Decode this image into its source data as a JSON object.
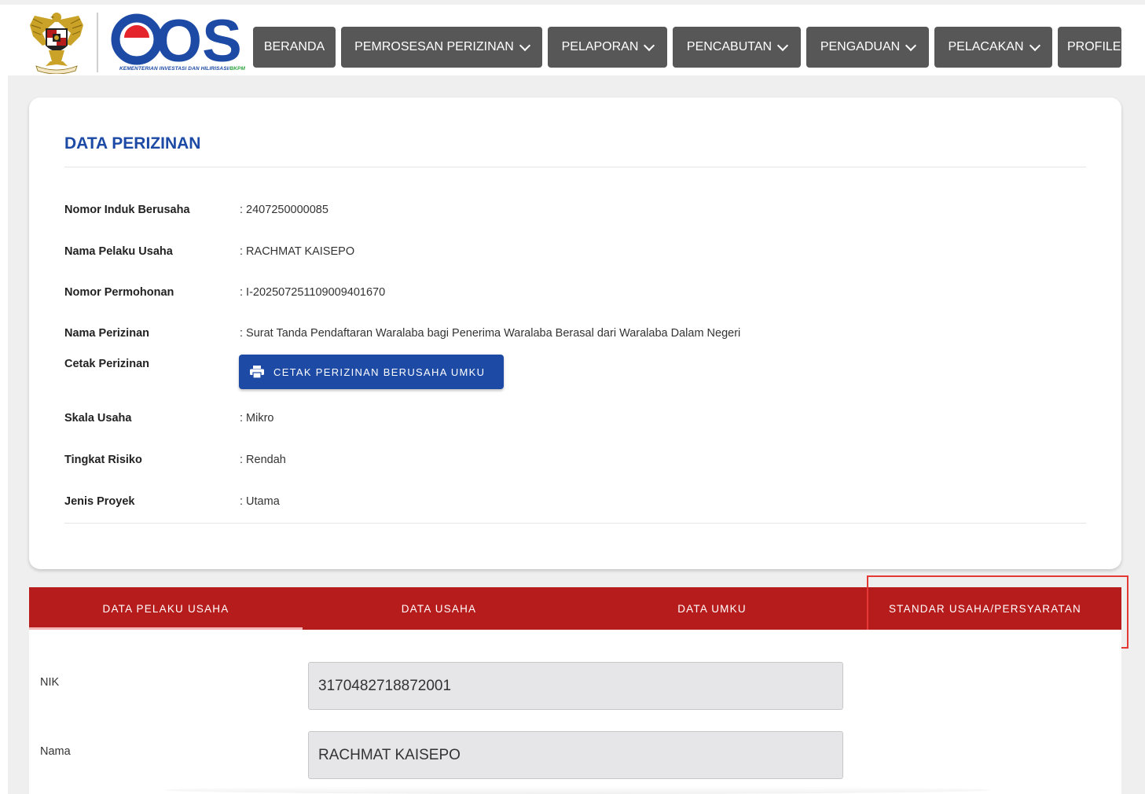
{
  "header": {
    "logo_text": "OSS",
    "logo_subtitle": "KEMENTERIAN INVESTASI DAN HILIRISASI/",
    "logo_subtitle_accent": "BKPM",
    "nav": [
      {
        "label": "BERANDA"
      },
      {
        "label": "PEMROSESAN PERIZINAN"
      },
      {
        "label": "PELAPORAN"
      },
      {
        "label": "PENCABUTAN"
      },
      {
        "label": "PENGADUAN"
      },
      {
        "label": "PELACAKAN"
      },
      {
        "label": "PROFILE"
      }
    ]
  },
  "card": {
    "title": "DATA PERIZINAN",
    "rows": [
      {
        "label": "Nomor Induk Berusaha",
        "value": ": 2407250000085"
      },
      {
        "label": "Nama Pelaku Usaha",
        "value": ": RACHMAT KAISEPO"
      },
      {
        "label": "Nomor Permohonan",
        "value": ": I-202507251109009401670"
      },
      {
        "label": "Nama Perizinan",
        "value": ": Surat Tanda Pendaftaran Waralaba bagi Penerima Waralaba Berasal dari Waralaba Dalam Negeri"
      },
      {
        "label": "Cetak Perizinan",
        "value": ""
      },
      {
        "label": "Skala Usaha",
        "value": ": Mikro"
      },
      {
        "label": "Tingkat Risiko",
        "value": ": Rendah"
      },
      {
        "label": "Jenis Proyek",
        "value": ": Utama"
      }
    ],
    "print_button_label": "CETAK PERIZINAN BERUSAHA UMKU"
  },
  "tabs": [
    {
      "label": "DATA PELAKU USAHA",
      "active": true
    },
    {
      "label": "DATA USAHA",
      "active": false
    },
    {
      "label": "DATA UMKU",
      "active": false
    },
    {
      "label": "STANDAR USAHA/PERSYARATAN",
      "active": false
    }
  ],
  "form": {
    "fields": [
      {
        "label": "NIK",
        "value": "3170482718872001"
      },
      {
        "label": "Nama",
        "value": "RACHMAT KAISEPO"
      }
    ]
  },
  "colors": {
    "primary_blue": "#1c4aa5",
    "tab_red": "#b71c1c",
    "nav_gray": "#575757",
    "highlight_red": "#e53935",
    "logo_red": "#e4262c"
  }
}
